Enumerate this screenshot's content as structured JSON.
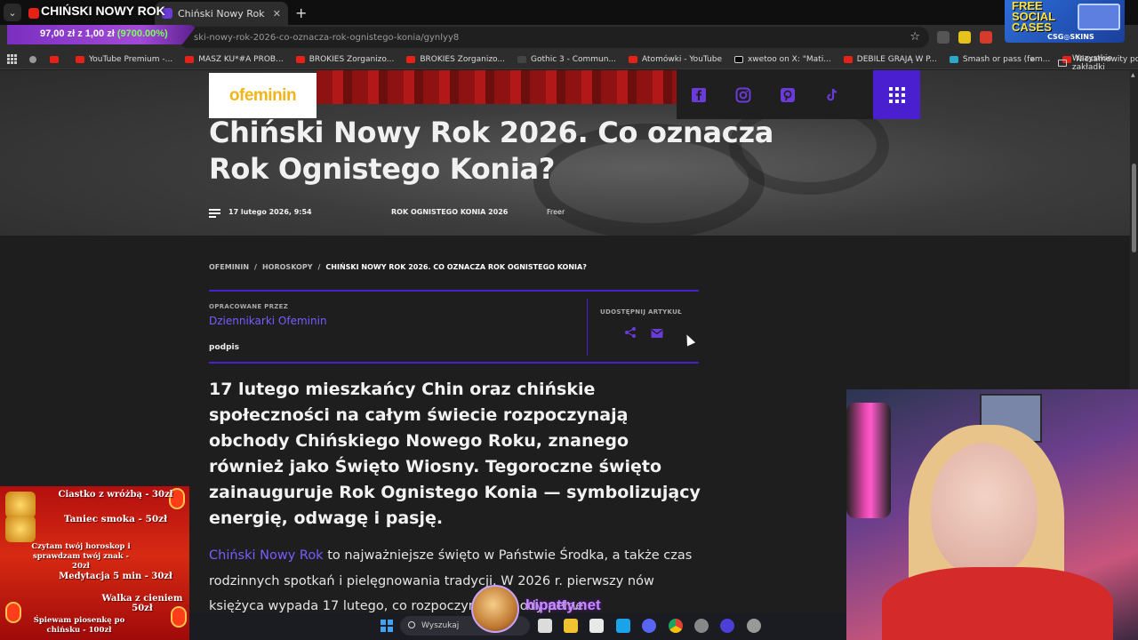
{
  "browser": {
    "overlay_title": "CHIŃSKI NOWY ROK",
    "tabs": [
      {
        "title": "",
        "active": false
      },
      {
        "title": "Chiński Nowy Rok 2026. Co ozn",
        "active": true
      }
    ],
    "url": "ski-nowy-rok-2026-co-oznacza-rok-ognistego-konia/gynlyy8",
    "donation": {
      "amount": "97,00 zł z 1,00 zł",
      "percent": "(9700.00%)"
    },
    "bookmarks": [
      "YouTube Premium -...",
      "MASZ KU*#A PROB...",
      "BROKIES Zorganizo...",
      "BROKIES Zorganizo...",
      "Gothic 3 - Commun...",
      "Atomówki - YouTube",
      "xwetoo on X: \"Mati...",
      "DEBILE GRAJĄ W P...",
      "Smash or pass (fem...",
      "Niesamowity pozio..."
    ],
    "all_bookmarks": "Wszystkie zakładki",
    "ad": {
      "line1": "FREE",
      "line2": "SOCIAL",
      "line3": "CASES",
      "brand": "CSG◎SKINS"
    }
  },
  "site": {
    "logo": "ofeminin",
    "social": [
      "facebook-icon",
      "instagram-icon",
      "pinterest-icon",
      "tiktok-icon"
    ]
  },
  "article": {
    "title": "Chiński Nowy Rok 2026. Co oznacza Rok Ognistego Konia?",
    "date": "17 lutego 2026, 9:54",
    "tag": "ROK OGNISTEGO KONIA 2026",
    "extra": "Freer",
    "breadcrumbs": [
      "OFEMININ",
      "HOROSKOPY",
      "CHIŃSKI NOWY ROK 2026. CO OZNACZA ROK OGNISTEGO KONIA?"
    ],
    "prepared_by_label": "OPRACOWANE PRZEZ",
    "author": "Dziennikarki Ofeminin",
    "signature": "podpis",
    "share_label": "UDOSTĘPNIJ ARTYKUŁ",
    "lead": "17 lutego mieszkańcy Chin oraz chińskie społeczności na całym świecie rozpoczynają obchody Chińskiego Nowego Roku, znanego również jako Święto Wiosny. Tegoroczne święto zainauguruje Rok Ognistego Konia — symbolizujący energię, odwagę i pasję.",
    "body_link": "Chiński Nowy Rok",
    "body_text": " to najważniejsze święto w Państwie Środka, a także czas rodzinnych spotkań i pielęgnowania tradycji. W 2026 r. pierwszy nów księżyca wypada 17 lutego, co rozpoczyna obchody pełne"
  },
  "stream": {
    "promo": [
      "Ciastko z wróżbą - 30zł",
      "Taniec smoka - 50zł",
      "Czytam twój horoskop i sprawdzam twój znak - 20zł",
      "Medytacja 5 min - 30zł",
      "Walka z cieniem 50zł",
      "Śpiewam piosenkę po chińsku - 100zł"
    ],
    "handle": "hipatty.net"
  },
  "taskbar": {
    "search_placeholder": "Wyszukaj"
  }
}
